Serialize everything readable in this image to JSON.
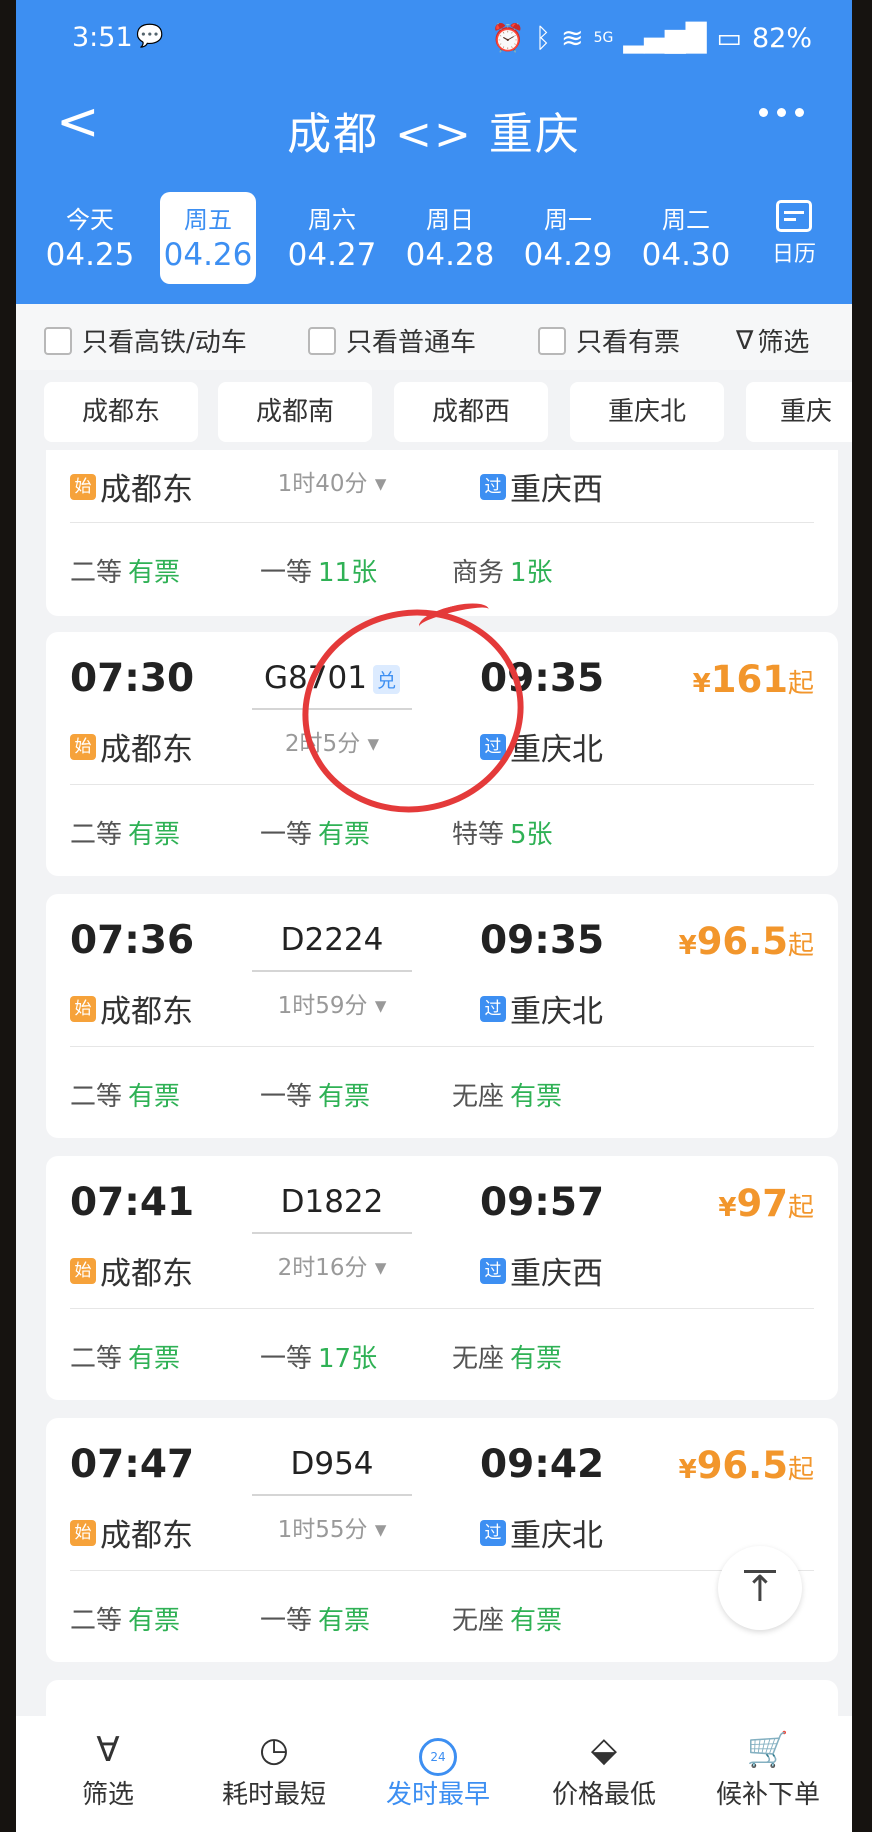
{
  "status_bar": {
    "time": "3:51",
    "battery": "82%",
    "network": "5G"
  },
  "header": {
    "back": "<",
    "title": "成都 <> 重庆"
  },
  "dates": [
    {
      "weekday": "今天",
      "date": "04.25"
    },
    {
      "weekday": "周五",
      "date": "04.26",
      "selected": true
    },
    {
      "weekday": "周六",
      "date": "04.27"
    },
    {
      "weekday": "周日",
      "date": "04.28"
    },
    {
      "weekday": "周一",
      "date": "04.29"
    },
    {
      "weekday": "周二",
      "date": "04.30"
    }
  ],
  "calendar_label": "日历",
  "filters": {
    "high_speed": "只看高铁/动车",
    "regular": "只看普通车",
    "available": "只看有票",
    "filter": "筛选"
  },
  "stations": [
    "成都东",
    "成都南",
    "成都西",
    "重庆北",
    "重庆"
  ],
  "trains": [
    {
      "dep_time": "",
      "train": "",
      "arr_time": "",
      "dep_station": "成都东",
      "dep_tag": "始",
      "duration": "1时40分",
      "arr_station": "重庆西",
      "arr_tag": "过",
      "price_value": "",
      "seats": [
        {
          "cls": "二等",
          "avail": "有票"
        },
        {
          "cls": "一等",
          "avail": "11张"
        },
        {
          "cls": "商务",
          "avail": "1张"
        }
      ]
    },
    {
      "dep_time": "07:30",
      "train": "G8701",
      "exchange": "兑",
      "arr_time": "09:35",
      "dep_station": "成都东",
      "dep_tag": "始",
      "duration": "2时5分",
      "arr_station": "重庆北",
      "arr_tag": "过",
      "price_value": "161",
      "seats": [
        {
          "cls": "二等",
          "avail": "有票"
        },
        {
          "cls": "一等",
          "avail": "有票"
        },
        {
          "cls": "特等",
          "avail": "5张"
        }
      ]
    },
    {
      "dep_time": "07:36",
      "train": "D2224",
      "arr_time": "09:35",
      "dep_station": "成都东",
      "dep_tag": "始",
      "duration": "1时59分",
      "arr_station": "重庆北",
      "arr_tag": "过",
      "price_value": "96.5",
      "seats": [
        {
          "cls": "二等",
          "avail": "有票"
        },
        {
          "cls": "一等",
          "avail": "有票"
        },
        {
          "cls": "无座",
          "avail": "有票"
        }
      ]
    },
    {
      "dep_time": "07:41",
      "train": "D1822",
      "arr_time": "09:57",
      "dep_station": "成都东",
      "dep_tag": "始",
      "duration": "2时16分",
      "arr_station": "重庆西",
      "arr_tag": "过",
      "price_value": "97",
      "seats": [
        {
          "cls": "二等",
          "avail": "有票"
        },
        {
          "cls": "一等",
          "avail": "17张"
        },
        {
          "cls": "无座",
          "avail": "有票"
        }
      ]
    },
    {
      "dep_time": "07:47",
      "train": "D954",
      "arr_time": "09:42",
      "dep_station": "成都东",
      "dep_tag": "始",
      "duration": "1时55分",
      "arr_station": "重庆北",
      "arr_tag": "过",
      "price_value": "96.5",
      "seats": [
        {
          "cls": "二等",
          "avail": "有票"
        },
        {
          "cls": "一等",
          "avail": "有票"
        },
        {
          "cls": "无座",
          "avail": "有票"
        }
      ]
    }
  ],
  "price_prefix": "¥",
  "price_suffix": "起",
  "bottom_nav": [
    {
      "label": "筛选",
      "icon": "filter-icon"
    },
    {
      "label": "耗时最短",
      "icon": "clock-icon"
    },
    {
      "label": "发时最早",
      "icon": "24h-icon",
      "badge": "24",
      "active": true
    },
    {
      "label": "价格最低",
      "icon": "price-tag-icon"
    },
    {
      "label": "候补下单",
      "icon": "cart-icon"
    }
  ],
  "colors": {
    "primary": "#3d8ff2",
    "price": "#f2962c",
    "available": "#2fb155",
    "annotation": "#e43a3a"
  }
}
